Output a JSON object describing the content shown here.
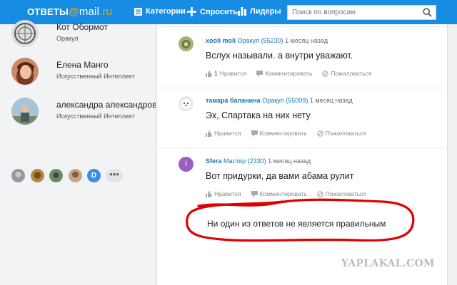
{
  "header": {
    "logo_prefix": "ОТВЕТЫ",
    "logo_at": "@",
    "logo_mail": "mail",
    "logo_dot": ".",
    "logo_ru": "ru",
    "nav": {
      "categories": "Категории",
      "ask": "Спросить",
      "leaders": "Лидеры"
    },
    "search": {
      "placeholder": "Поиск по вопросам",
      "value": ""
    }
  },
  "sidebar": {
    "users": [
      {
        "name": "Кот Обормот",
        "rank": "Оракул"
      },
      {
        "name": "Елена Манго",
        "rank": "Искусственный Интеллект"
      },
      {
        "name": "александра александрова",
        "rank": "Искусственный Интеллект"
      }
    ],
    "extra_avatar_letter": "D",
    "more_label": "•••"
  },
  "answers": [
    {
      "user": "xooli moli",
      "rank": "Оракул (55230)",
      "time": "1 месяц назад",
      "text": "Вслух называли. а внутри уважают.",
      "likes_count": "1",
      "like_label": "Нравится",
      "comment_label": "Комментировать",
      "report_label": "Пожаловаться"
    },
    {
      "user": "тамара баланина",
      "rank": "Оракул (55009)",
      "time": "1 месяц назад",
      "text": "Эх, Спартака на них нету",
      "likes_count": "",
      "like_label": "Нравится",
      "comment_label": "Комментировать",
      "report_label": "Пожаловаться"
    },
    {
      "user": "Sfera",
      "rank": "Мастер (2330)",
      "time": "1 месяц назад",
      "text": "Вот придурки, да вами абама рулит",
      "likes_count": "",
      "like_label": "Нравится",
      "comment_label": "Комментировать",
      "report_label": "Пожаловаться",
      "avatar_letter": "I"
    }
  ],
  "verdict": "Ни один из ответов не является правильным",
  "watermark": "YAPLAKAL.COM",
  "colors": {
    "header": "#168de2",
    "link": "#1576b8",
    "marker": "#e00000",
    "avatar_purple": "#9b5fc0"
  }
}
